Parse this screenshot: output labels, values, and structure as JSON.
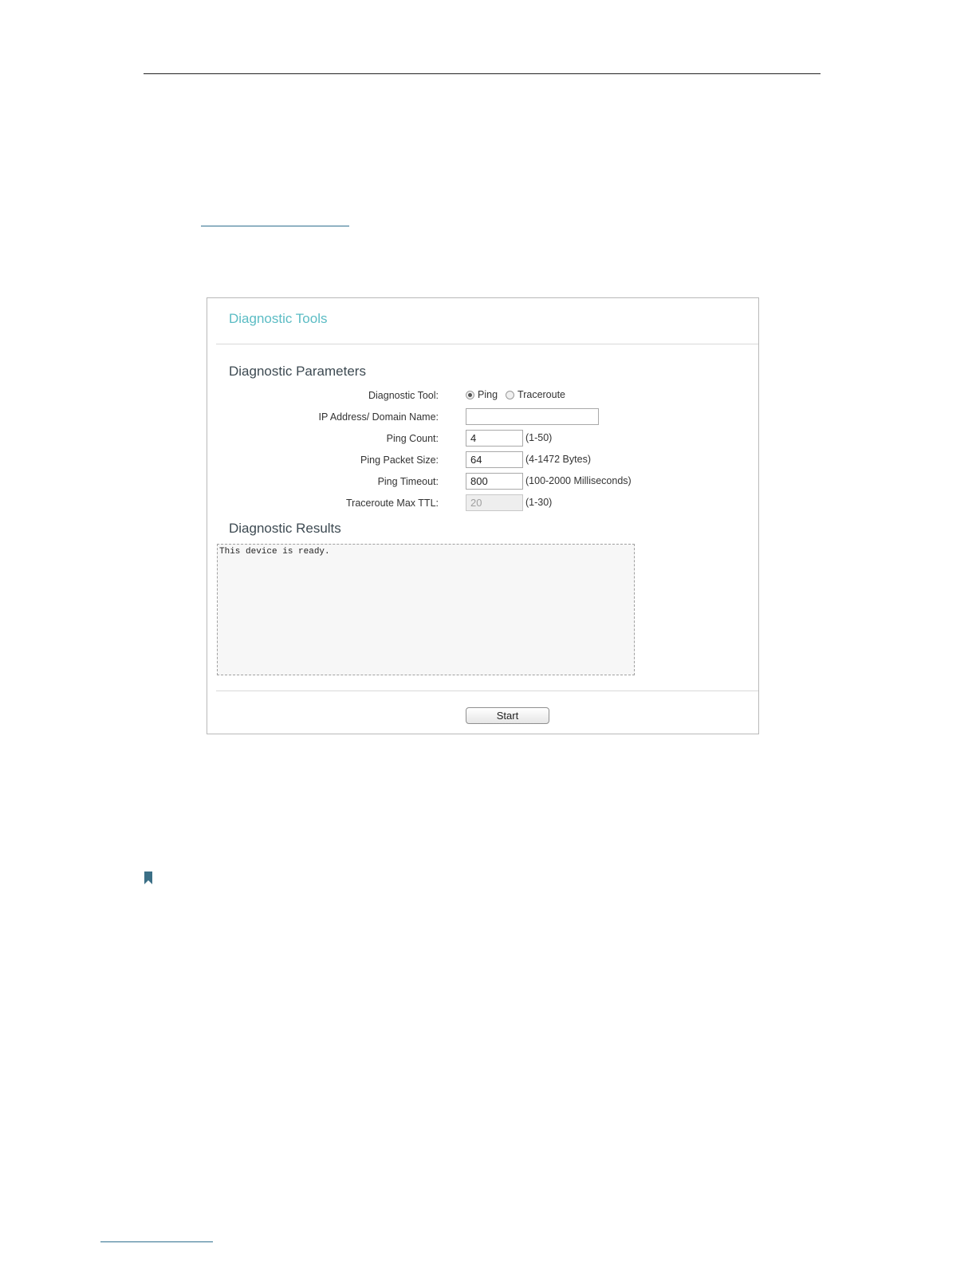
{
  "panel": {
    "title": "Diagnostic Tools",
    "parameters_title": "Diagnostic Parameters",
    "results_title": "Diagnostic Results",
    "fields": {
      "diagnostic_tool_label": "Diagnostic Tool:",
      "tool_options": [
        "Ping",
        "Traceroute"
      ],
      "tool_selected": "Ping",
      "ip_label": "IP Address/ Domain Name:",
      "ip_value": "",
      "ping_count_label": "Ping Count:",
      "ping_count_value": "4",
      "ping_count_hint": "(1-50)",
      "packet_size_label": "Ping Packet Size:",
      "packet_size_value": "64",
      "packet_size_hint": "(4-1472 Bytes)",
      "timeout_label": "Ping Timeout:",
      "timeout_value": "800",
      "timeout_hint": "(100-2000 Milliseconds)",
      "ttl_label": "Traceroute Max TTL:",
      "ttl_value": "20",
      "ttl_hint": "(1-30)"
    },
    "results_text": "This device is ready.",
    "start_label": "Start"
  },
  "colors": {
    "title": "#5bbcc4",
    "section": "#3d4a52",
    "link_rule": "#2f6f8f"
  },
  "icons": {
    "note": "bookmark-icon"
  }
}
